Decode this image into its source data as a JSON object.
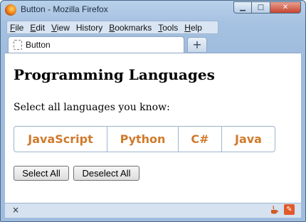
{
  "window": {
    "title": "Button - Mozilla Firefox",
    "controls": {
      "minimize": "▁",
      "maximize": "□",
      "close": "✕"
    }
  },
  "menubar": {
    "items": [
      {
        "accel": "F",
        "rest": "ile"
      },
      {
        "accel": "E",
        "rest": "dit"
      },
      {
        "accel": "V",
        "rest": "iew"
      },
      {
        "accel": "",
        "rest": "History",
        "accel_after": "H"
      },
      {
        "accel": "B",
        "rest": "ookmarks"
      },
      {
        "accel": "T",
        "rest": "ools"
      },
      {
        "accel": "H",
        "rest": "elp"
      }
    ]
  },
  "tabs": [
    {
      "label": "Button",
      "icon": "blank-page-icon"
    }
  ],
  "new_tab_label": "+",
  "page": {
    "title": "Programming Languages",
    "instruction": "Select all languages you know:",
    "languages": [
      "JavaScript",
      "Python",
      "C#",
      "Java"
    ],
    "actions": {
      "select_all": "Select All",
      "deselect_all": "Deselect All"
    }
  },
  "statusbar": {
    "close_glyph": "×",
    "addon_icons": [
      "java-cup-icon",
      "pdf-icon"
    ]
  },
  "colors": {
    "language_text": "#d07a2c",
    "frame": "#a6c2e2"
  }
}
